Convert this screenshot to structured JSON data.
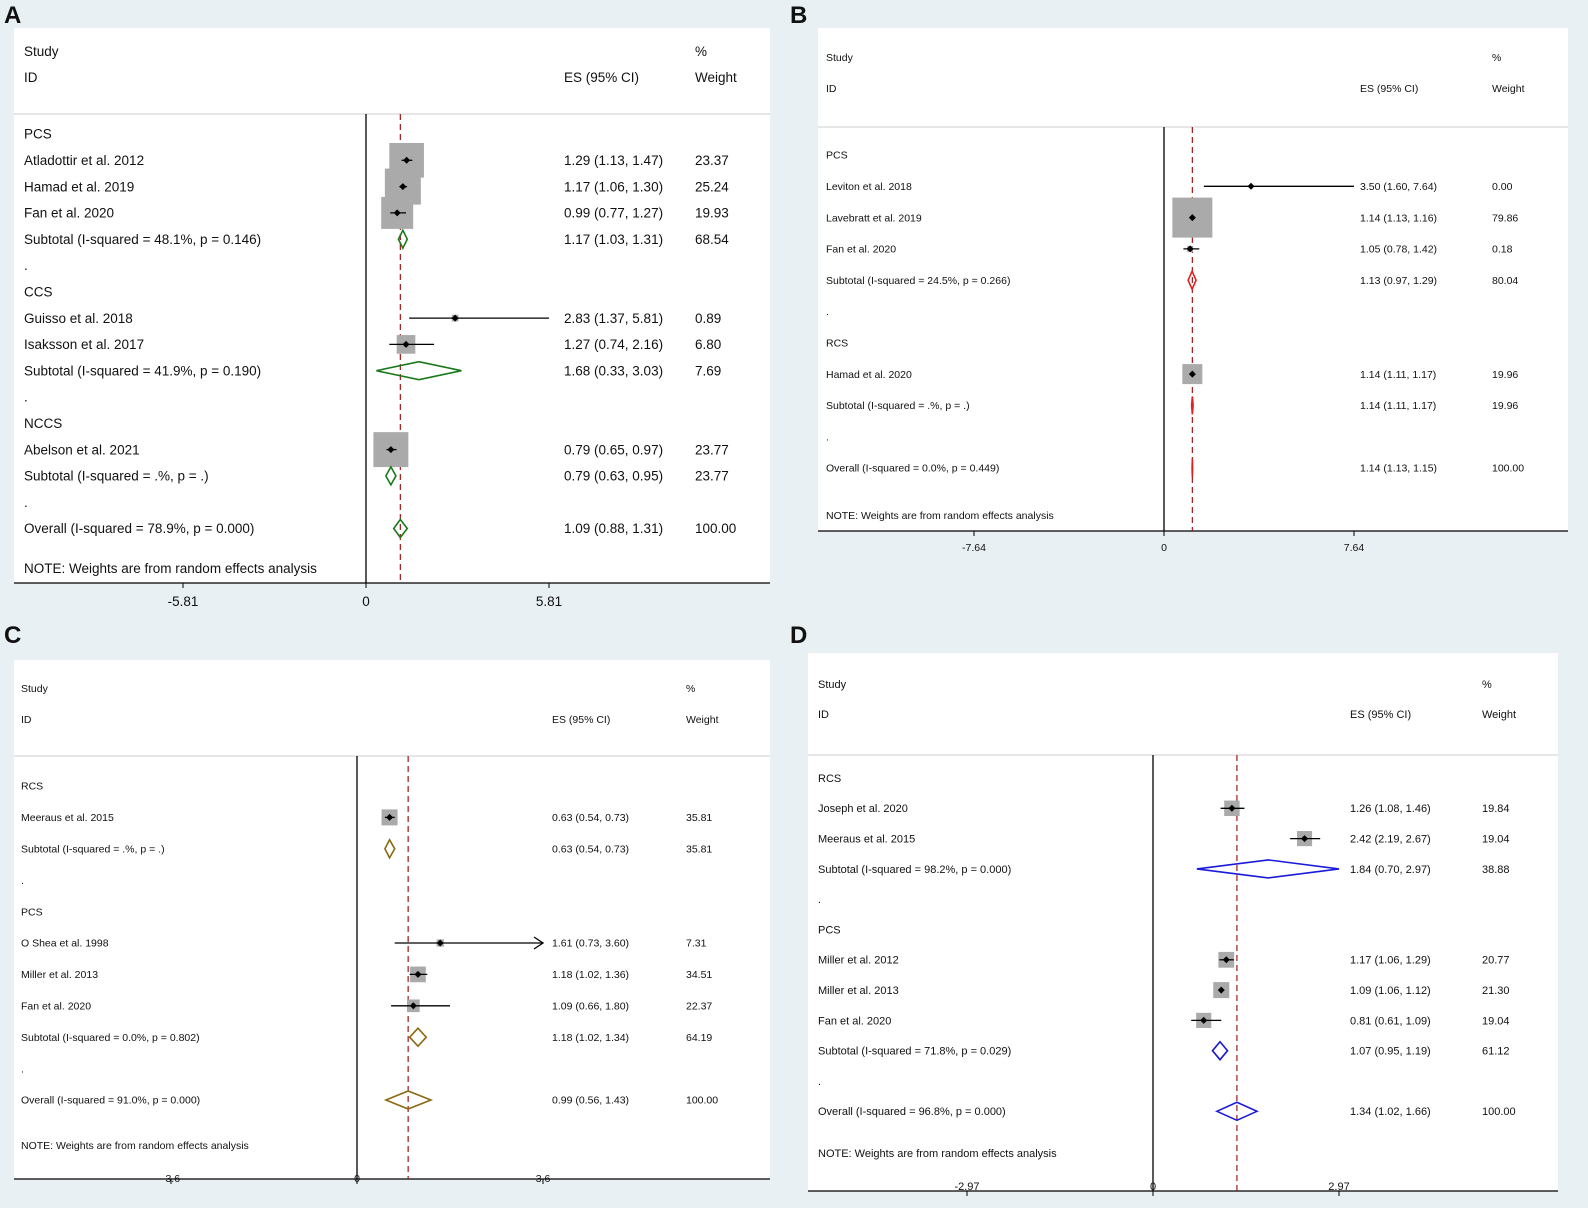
{
  "chart_data": [
    {
      "panel": "A",
      "type": "forest",
      "headers": {
        "study_top": "Study",
        "study_bottom": "ID",
        "es": "ES (95% CI)",
        "weight_top": "%",
        "weight_bottom": "Weight"
      },
      "xlim": [
        -5.81,
        5.81
      ],
      "ticks": [
        "-5.81",
        "0",
        "5.81"
      ],
      "tick_values": [
        -5.81,
        0,
        5.81
      ],
      "ref_line": 1.09,
      "diamond_color": "#1a7a1a",
      "note": "NOTE: Weights are from random effects analysis",
      "rows": [
        {
          "kind": "group",
          "label": "PCS"
        },
        {
          "kind": "study",
          "label": "Atladottir   et al. 2012",
          "es": 1.29,
          "lo": 1.13,
          "hi": 1.47,
          "ci_text": "1.29 (1.13, 1.47)",
          "weight": "23.37",
          "w": 23.37
        },
        {
          "kind": "study",
          "label": "Hamad et al. 2019",
          "es": 1.17,
          "lo": 1.06,
          "hi": 1.3,
          "ci_text": "1.17 (1.06, 1.30)",
          "weight": "25.24",
          "w": 25.24
        },
        {
          "kind": "study",
          "label": "Fan et al. 2020",
          "es": 0.99,
          "lo": 0.77,
          "hi": 1.27,
          "ci_text": "0.99 (0.77, 1.27)",
          "weight": "19.93",
          "w": 19.93
        },
        {
          "kind": "subtotal",
          "label": "Subtotal  (I-squared = 48.1%, p = 0.146)",
          "es": 1.17,
          "lo": 1.03,
          "hi": 1.31,
          "ci_text": "1.17 (1.03, 1.31)",
          "weight": "68.54"
        },
        {
          "kind": "dot",
          "label": "."
        },
        {
          "kind": "group",
          "label": "CCS"
        },
        {
          "kind": "study",
          "label": "Guisso et al. 2018",
          "es": 2.83,
          "lo": 1.37,
          "hi": 5.81,
          "ci_text": "2.83 (1.37, 5.81)",
          "weight": "0.89",
          "w": 0.89
        },
        {
          "kind": "study",
          "label": "Isaksson et al. 2017",
          "es": 1.27,
          "lo": 0.74,
          "hi": 2.16,
          "ci_text": "1.27 (0.74, 2.16)",
          "weight": "6.80",
          "w": 6.8
        },
        {
          "kind": "subtotal",
          "label": "Subtotal  (I-squared = 41.9%, p = 0.190)",
          "es": 1.68,
          "lo": 0.33,
          "hi": 3.03,
          "ci_text": "1.68 (0.33, 3.03)",
          "weight": "7.69"
        },
        {
          "kind": "dot",
          "label": "."
        },
        {
          "kind": "group",
          "label": "NCCS"
        },
        {
          "kind": "study",
          "label": "Abelson et al. 2021",
          "es": 0.79,
          "lo": 0.65,
          "hi": 0.97,
          "ci_text": "0.79 (0.65, 0.97)",
          "weight": "23.77",
          "w": 23.77
        },
        {
          "kind": "subtotal",
          "label": "Subtotal  (I-squared = .%, p = .)",
          "es": 0.79,
          "lo": 0.63,
          "hi": 0.95,
          "ci_text": "0.79 (0.63, 0.95)",
          "weight": "23.77"
        },
        {
          "kind": "dot",
          "label": "."
        },
        {
          "kind": "overall",
          "label": "Overall  (I-squared = 78.9%, p = 0.000)",
          "es": 1.09,
          "lo": 0.88,
          "hi": 1.31,
          "ci_text": "1.09 (0.88, 1.31)",
          "weight": "100.00"
        }
      ]
    },
    {
      "panel": "B",
      "type": "forest",
      "headers": {
        "study_top": "Study",
        "study_bottom": "ID",
        "es": "ES (95% CI)",
        "weight_top": "%",
        "weight_bottom": "Weight"
      },
      "xlim": [
        -7.64,
        7.64
      ],
      "ticks": [
        "-7.64",
        "0",
        "7.64"
      ],
      "tick_values": [
        -7.64,
        0,
        7.64
      ],
      "ref_line": 1.14,
      "diamond_color": "#e02020",
      "note": "NOTE: Weights are from random effects analysis",
      "rows": [
        {
          "kind": "group",
          "label": "PCS"
        },
        {
          "kind": "study",
          "label": "Leviton et al. 2018",
          "es": 3.5,
          "lo": 1.6,
          "hi": 7.64,
          "ci_text": "3.50 (1.60, 7.64)",
          "weight": "0.00",
          "w": 0.0
        },
        {
          "kind": "study",
          "label": "Lavebratt et al. 2019",
          "es": 1.14,
          "lo": 1.13,
          "hi": 1.16,
          "ci_text": "1.14 (1.13, 1.16)",
          "weight": "79.86",
          "w": 79.86
        },
        {
          "kind": "study",
          "label": "Fan et al. 2020",
          "es": 1.05,
          "lo": 0.78,
          "hi": 1.42,
          "ci_text": "1.05 (0.78, 1.42)",
          "weight": "0.18",
          "w": 0.18
        },
        {
          "kind": "subtotal",
          "label": "Subtotal  (I-squared = 24.5%, p = 0.266)",
          "es": 1.13,
          "lo": 0.97,
          "hi": 1.29,
          "ci_text": "1.13 (0.97, 1.29)",
          "weight": "80.04"
        },
        {
          "kind": "dot",
          "label": "."
        },
        {
          "kind": "group",
          "label": "RCS"
        },
        {
          "kind": "study",
          "label": "Hamad et al. 2020",
          "es": 1.14,
          "lo": 1.11,
          "hi": 1.17,
          "ci_text": "1.14 (1.11, 1.17)",
          "weight": "19.96",
          "w": 19.96
        },
        {
          "kind": "subtotal",
          "label": "Subtotal  (I-squared = .%, p = .)",
          "es": 1.14,
          "lo": 1.11,
          "hi": 1.17,
          "ci_text": "1.14 (1.11, 1.17)",
          "weight": "19.96"
        },
        {
          "kind": "dot",
          "label": "."
        },
        {
          "kind": "overall",
          "label": "Overall  (I-squared = 0.0%, p = 0.449)",
          "es": 1.14,
          "lo": 1.13,
          "hi": 1.15,
          "ci_text": "1.14 (1.13, 1.15)",
          "weight": "100.00"
        }
      ]
    },
    {
      "panel": "C",
      "type": "forest",
      "headers": {
        "study_top": "Study",
        "study_bottom": "ID",
        "es": "ES (95% CI)",
        "weight_top": "%",
        "weight_bottom": "Weight"
      },
      "xlim": [
        -3.6,
        3.6
      ],
      "ticks": [
        "-3.6",
        "0",
        "3.6"
      ],
      "tick_values": [
        -3.6,
        0,
        3.6
      ],
      "ref_line": 0.99,
      "diamond_color": "#8a6a10",
      "note": "NOTE: Weights are from random effects analysis",
      "rows": [
        {
          "kind": "group",
          "label": "RCS"
        },
        {
          "kind": "study",
          "label": "Meeraus et al. 2015",
          "es": 0.63,
          "lo": 0.54,
          "hi": 0.73,
          "ci_text": "0.63 (0.54, 0.73)",
          "weight": "35.81",
          "w": 35.81
        },
        {
          "kind": "subtotal",
          "label": "Subtotal  (I-squared = .%, p = .)",
          "es": 0.63,
          "lo": 0.54,
          "hi": 0.73,
          "ci_text": "0.63 (0.54, 0.73)",
          "weight": "35.81"
        },
        {
          "kind": "dot",
          "label": "."
        },
        {
          "kind": "group",
          "label": "PCS"
        },
        {
          "kind": "study",
          "label": "O Shea et al. 1998",
          "es": 1.61,
          "lo": 0.73,
          "hi": 3.6,
          "ci_text": "1.61 (0.73, 3.60)",
          "weight": "7.31",
          "w": 7.31,
          "arrow": true
        },
        {
          "kind": "study",
          "label": "Miller et al. 2013",
          "es": 1.18,
          "lo": 1.02,
          "hi": 1.36,
          "ci_text": "1.18 (1.02, 1.36)",
          "weight": "34.51",
          "w": 34.51
        },
        {
          "kind": "study",
          "label": "Fan et al. 2020",
          "es": 1.09,
          "lo": 0.66,
          "hi": 1.8,
          "ci_text": "1.09 (0.66, 1.80)",
          "weight": "22.37",
          "w": 22.37
        },
        {
          "kind": "subtotal",
          "label": "Subtotal  (I-squared = 0.0%, p = 0.802)",
          "es": 1.18,
          "lo": 1.02,
          "hi": 1.34,
          "ci_text": "1.18 (1.02, 1.34)",
          "weight": "64.19"
        },
        {
          "kind": "dot",
          "label": "."
        },
        {
          "kind": "overall",
          "label": "Overall  (I-squared = 91.0%, p = 0.000)",
          "es": 0.99,
          "lo": 0.56,
          "hi": 1.43,
          "ci_text": "0.99 (0.56, 1.43)",
          "weight": "100.00"
        }
      ]
    },
    {
      "panel": "D",
      "type": "forest",
      "headers": {
        "study_top": "Study",
        "study_bottom": "ID",
        "es": "ES (95% CI)",
        "weight_top": "%",
        "weight_bottom": "Weight"
      },
      "xlim": [
        -2.97,
        2.97
      ],
      "ticks": [
        "-2.97",
        "0",
        "2.97"
      ],
      "tick_values": [
        -2.97,
        0,
        2.97
      ],
      "ref_line": 1.34,
      "diamond_color": "#1a1ad8",
      "note": "NOTE: Weights are from random effects analysis",
      "rows": [
        {
          "kind": "group",
          "label": "RCS"
        },
        {
          "kind": "study",
          "label": "Joseph et al. 2020",
          "es": 1.26,
          "lo": 1.08,
          "hi": 1.46,
          "ci_text": "1.26 (1.08, 1.46)",
          "weight": "19.84",
          "w": 19.84
        },
        {
          "kind": "study",
          "label": "Meeraus et al. 2015",
          "es": 2.42,
          "lo": 2.19,
          "hi": 2.67,
          "ci_text": "2.42 (2.19, 2.67)",
          "weight": "19.04",
          "w": 19.04
        },
        {
          "kind": "subtotal",
          "label": "Subtotal  (I-squared = 98.2%, p = 0.000)",
          "es": 1.84,
          "lo": 0.7,
          "hi": 2.97,
          "ci_text": "1.84 (0.70, 2.97)",
          "weight": "38.88"
        },
        {
          "kind": "dot",
          "label": "."
        },
        {
          "kind": "group",
          "label": "PCS"
        },
        {
          "kind": "study",
          "label": "Miller et al. 2012",
          "es": 1.17,
          "lo": 1.06,
          "hi": 1.29,
          "ci_text": "1.17 (1.06, 1.29)",
          "weight": "20.77",
          "w": 20.77
        },
        {
          "kind": "study",
          "label": "Miller et al. 2013",
          "es": 1.09,
          "lo": 1.06,
          "hi": 1.12,
          "ci_text": "1.09 (1.06, 1.12)",
          "weight": "21.30",
          "w": 21.3
        },
        {
          "kind": "study",
          "label": "Fan et al. 2020",
          "es": 0.81,
          "lo": 0.61,
          "hi": 1.09,
          "ci_text": "0.81 (0.61, 1.09)",
          "weight": "19.04",
          "w": 19.04
        },
        {
          "kind": "subtotal",
          "label": "Subtotal  (I-squared = 71.8%, p = 0.029)",
          "es": 1.07,
          "lo": 0.95,
          "hi": 1.19,
          "ci_text": "1.07 (0.95, 1.19)",
          "weight": "61.12"
        },
        {
          "kind": "dot",
          "label": "."
        },
        {
          "kind": "overall",
          "label": "Overall  (I-squared = 96.8%, p = 0.000)",
          "es": 1.34,
          "lo": 1.02,
          "hi": 1.66,
          "ci_text": "1.34 (1.02, 1.66)",
          "weight": "100.00"
        }
      ]
    }
  ]
}
